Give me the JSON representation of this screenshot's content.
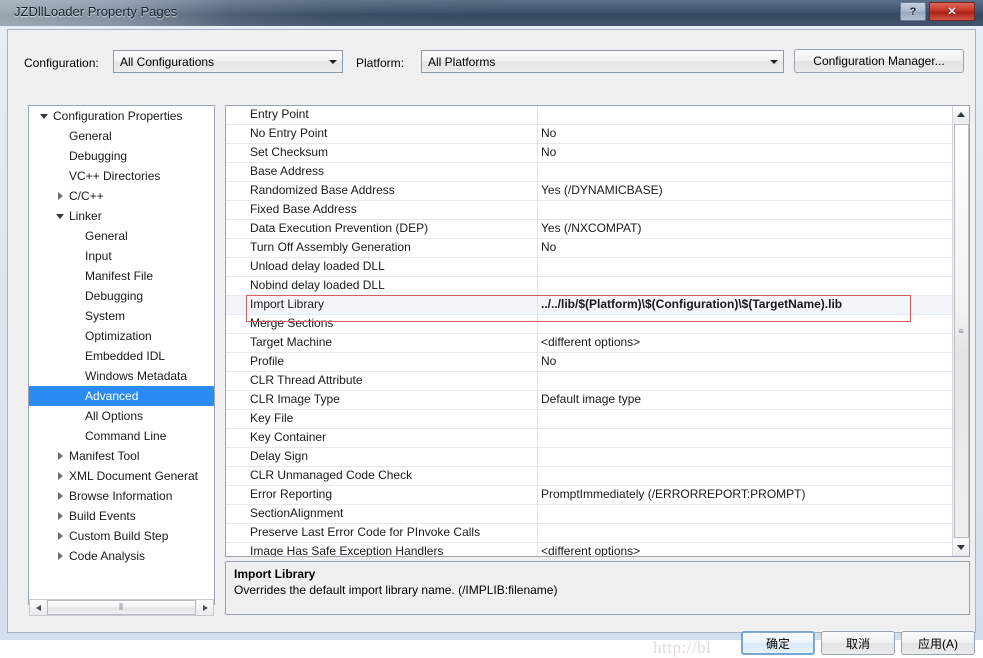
{
  "window": {
    "title": "JZDllLoader Property Pages",
    "help_button": "?",
    "close_button": "✕"
  },
  "toolbar": {
    "configuration_label": "Configuration:",
    "configuration_value": "All Configurations",
    "platform_label": "Platform:",
    "platform_value": "All Platforms",
    "configuration_manager_label": "Configuration Manager..."
  },
  "tree": {
    "items": [
      {
        "label": "Configuration Properties",
        "indent": 0,
        "arrow": "expanded",
        "selected": false
      },
      {
        "label": "General",
        "indent": 1,
        "arrow": "none",
        "selected": false
      },
      {
        "label": "Debugging",
        "indent": 1,
        "arrow": "none",
        "selected": false
      },
      {
        "label": "VC++ Directories",
        "indent": 1,
        "arrow": "none",
        "selected": false
      },
      {
        "label": "C/C++",
        "indent": 1,
        "arrow": "collapsed",
        "selected": false
      },
      {
        "label": "Linker",
        "indent": 1,
        "arrow": "expanded",
        "selected": false
      },
      {
        "label": "General",
        "indent": 2,
        "arrow": "none",
        "selected": false
      },
      {
        "label": "Input",
        "indent": 2,
        "arrow": "none",
        "selected": false
      },
      {
        "label": "Manifest File",
        "indent": 2,
        "arrow": "none",
        "selected": false
      },
      {
        "label": "Debugging",
        "indent": 2,
        "arrow": "none",
        "selected": false
      },
      {
        "label": "System",
        "indent": 2,
        "arrow": "none",
        "selected": false
      },
      {
        "label": "Optimization",
        "indent": 2,
        "arrow": "none",
        "selected": false
      },
      {
        "label": "Embedded IDL",
        "indent": 2,
        "arrow": "none",
        "selected": false
      },
      {
        "label": "Windows Metadata",
        "indent": 2,
        "arrow": "none",
        "selected": false
      },
      {
        "label": "Advanced",
        "indent": 2,
        "arrow": "none",
        "selected": true
      },
      {
        "label": "All Options",
        "indent": 2,
        "arrow": "none",
        "selected": false
      },
      {
        "label": "Command Line",
        "indent": 2,
        "arrow": "none",
        "selected": false
      },
      {
        "label": "Manifest Tool",
        "indent": 1,
        "arrow": "collapsed",
        "selected": false
      },
      {
        "label": "XML Document Generat",
        "indent": 1,
        "arrow": "collapsed",
        "selected": false
      },
      {
        "label": "Browse Information",
        "indent": 1,
        "arrow": "collapsed",
        "selected": false
      },
      {
        "label": "Build Events",
        "indent": 1,
        "arrow": "collapsed",
        "selected": false
      },
      {
        "label": "Custom Build Step",
        "indent": 1,
        "arrow": "collapsed",
        "selected": false
      },
      {
        "label": "Code Analysis",
        "indent": 1,
        "arrow": "collapsed",
        "selected": false
      }
    ]
  },
  "grid": {
    "rows": [
      {
        "name": "Entry Point",
        "value": "",
        "highlighted": false
      },
      {
        "name": "No Entry Point",
        "value": "No",
        "highlighted": false
      },
      {
        "name": "Set Checksum",
        "value": "No",
        "highlighted": false
      },
      {
        "name": "Base Address",
        "value": "",
        "highlighted": false
      },
      {
        "name": "Randomized Base Address",
        "value": "Yes (/DYNAMICBASE)",
        "highlighted": false
      },
      {
        "name": "Fixed Base Address",
        "value": "",
        "highlighted": false
      },
      {
        "name": "Data Execution Prevention (DEP)",
        "value": "Yes (/NXCOMPAT)",
        "highlighted": false
      },
      {
        "name": "Turn Off Assembly Generation",
        "value": "No",
        "highlighted": false
      },
      {
        "name": "Unload delay loaded DLL",
        "value": "",
        "highlighted": false
      },
      {
        "name": "Nobind delay loaded DLL",
        "value": "",
        "highlighted": false
      },
      {
        "name": "Import Library",
        "value": "../../lib/$(Platform)\\$(Configuration)\\$(TargetName).lib",
        "highlighted": true
      },
      {
        "name": "Merge Sections",
        "value": "",
        "highlighted": false
      },
      {
        "name": "Target Machine",
        "value": "<different options>",
        "highlighted": false
      },
      {
        "name": "Profile",
        "value": "No",
        "highlighted": false
      },
      {
        "name": "CLR Thread Attribute",
        "value": "",
        "highlighted": false
      },
      {
        "name": "CLR Image Type",
        "value": "Default image type",
        "highlighted": false
      },
      {
        "name": "Key File",
        "value": "",
        "highlighted": false
      },
      {
        "name": "Key Container",
        "value": "",
        "highlighted": false
      },
      {
        "name": "Delay Sign",
        "value": "",
        "highlighted": false
      },
      {
        "name": "CLR Unmanaged Code Check",
        "value": "",
        "highlighted": false
      },
      {
        "name": "Error Reporting",
        "value": "PromptImmediately (/ERRORREPORT:PROMPT)",
        "highlighted": false
      },
      {
        "name": "SectionAlignment",
        "value": "",
        "highlighted": false
      },
      {
        "name": "Preserve Last Error Code for PInvoke Calls",
        "value": "",
        "highlighted": false
      },
      {
        "name": "Image Has Safe Exception Handlers",
        "value": "<different options>",
        "highlighted": false
      }
    ]
  },
  "description": {
    "title": "Import Library",
    "body": "Overrides the default import library name. (/IMPLIB:filename)"
  },
  "buttons": {
    "ok": "确定",
    "cancel": "取消",
    "apply": "应用(A)"
  },
  "watermark": {
    "text": "http://bl"
  },
  "colors": {
    "selection": "#2a8bf2",
    "highlight_border": "#d85b5b",
    "close_button": "#c53427"
  }
}
